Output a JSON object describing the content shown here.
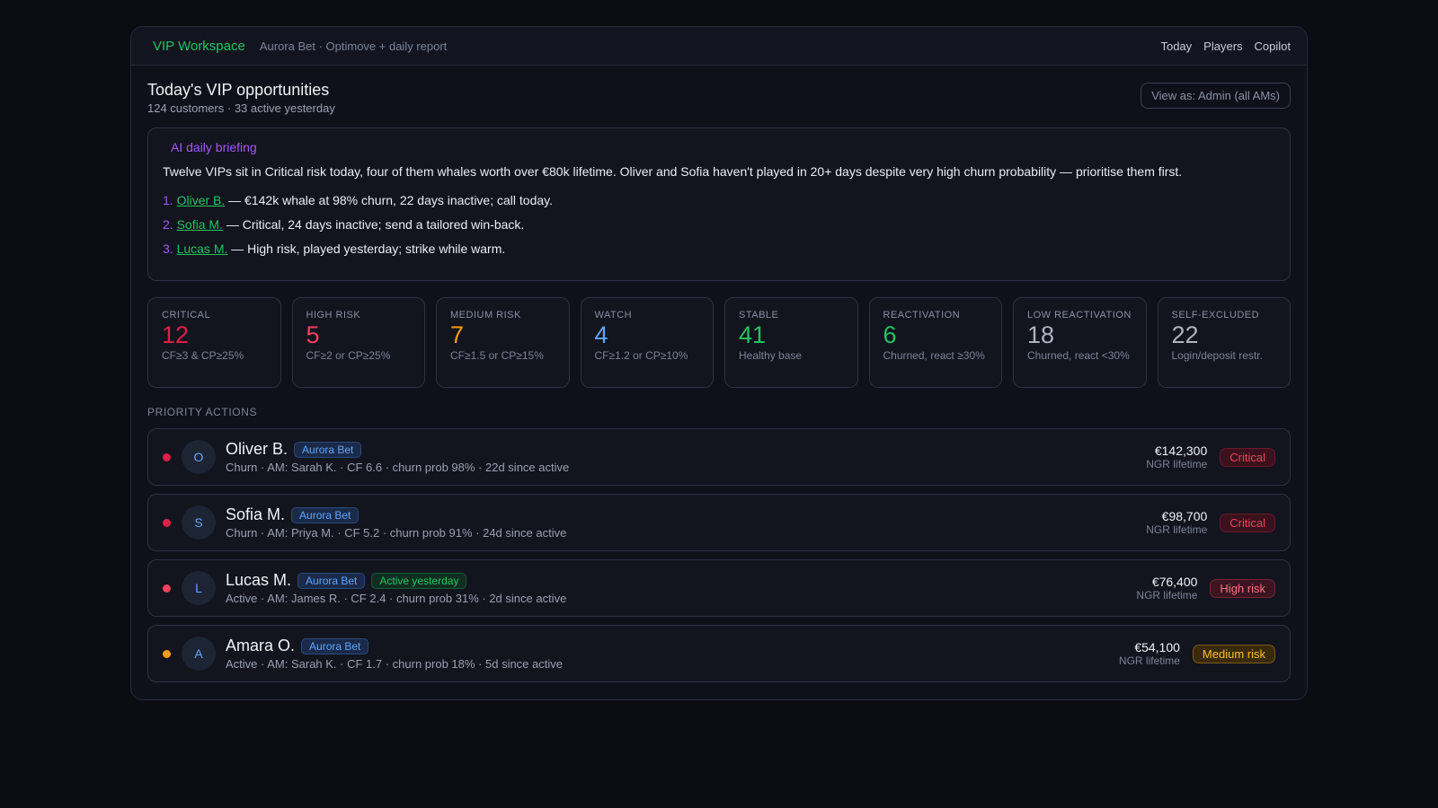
{
  "header": {
    "brand": "VIP Workspace",
    "subtitle": "Aurora Bet · Optimove + daily report",
    "nav": [
      "Today",
      "Players",
      "Copilot"
    ]
  },
  "page": {
    "title": "Today's VIP opportunities",
    "counts": "124 customers · 33 active yesterday",
    "view_as": "View as: Admin (all AMs)"
  },
  "briefing": {
    "label": "AI daily briefing",
    "text": "Twelve VIPs sit in Critical risk today, four of them whales worth over €80k lifetime. Oliver and Sofia haven't played in 20+ days despite very high churn probability — prioritise them first.",
    "items": [
      {
        "num": "1.",
        "name": "Oliver B.",
        "text": " — €142k whale at 98% churn, 22 days inactive; call today."
      },
      {
        "num": "2.",
        "name": "Sofia M.",
        "text": " — Critical, 24 days inactive; send a tailored win-back."
      },
      {
        "num": "3.",
        "name": "Lucas M.",
        "text": " — High risk, played yesterday; strike while warm."
      }
    ]
  },
  "stats": [
    {
      "label": "Critical",
      "value": "12",
      "desc": "CF≥3 & CP≥25%",
      "color": "#e11d48"
    },
    {
      "label": "High risk",
      "value": "5",
      "desc": "CF≥2 or CP≥25%",
      "color": "#f43f5e"
    },
    {
      "label": "Medium risk",
      "value": "7",
      "desc": "CF≥1.5 or CP≥15%",
      "color": "#f59e0b"
    },
    {
      "label": "Watch",
      "value": "4",
      "desc": "CF≥1.2 or CP≥10%",
      "color": "#60a5fa"
    },
    {
      "label": "Stable",
      "value": "41",
      "desc": "Healthy base",
      "color": "#22c55e"
    },
    {
      "label": "Reactivation",
      "value": "6",
      "desc": "Churned, react ≥30%",
      "color": "#22c55e"
    },
    {
      "label": "Low reactivation",
      "value": "18",
      "desc": "Churned, react <30%",
      "color": "#aeb3c0"
    },
    {
      "label": "Self-excluded",
      "value": "22",
      "desc": "Login/deposit restr.",
      "color": "#aeb3c0"
    }
  ],
  "priority_label": "Priority actions",
  "players": [
    {
      "initial": "O",
      "name": "Oliver B.",
      "brand": "Aurora Bet",
      "active_tag": "",
      "meta": "Churn · AM: Sarah K. · CF 6.6 · churn prob 98% · 22d since active",
      "amount": "€142,300",
      "ngr": "NGR lifetime",
      "badge": "Critical",
      "dot": "#e11d48",
      "badge_fg": "#f43f5e",
      "badge_bg": "#3a111c",
      "badge_border": "#6b1a2b"
    },
    {
      "initial": "S",
      "name": "Sofia M.",
      "brand": "Aurora Bet",
      "active_tag": "",
      "meta": "Churn · AM: Priya M. · CF 5.2 · churn prob 91% · 24d since active",
      "amount": "€98,700",
      "ngr": "NGR lifetime",
      "badge": "Critical",
      "dot": "#e11d48",
      "badge_fg": "#f43f5e",
      "badge_bg": "#3a111c",
      "badge_border": "#6b1a2b"
    },
    {
      "initial": "L",
      "name": "Lucas M.",
      "brand": "Aurora Bet",
      "active_tag": "Active yesterday",
      "meta": "Active · AM: James R. · CF 2.4 · churn prob 31% · 2d since active",
      "amount": "€76,400",
      "ngr": "NGR lifetime",
      "badge": "High risk",
      "dot": "#f43f5e",
      "badge_fg": "#fb7185",
      "badge_bg": "#3a1620",
      "badge_border": "#7a2436"
    },
    {
      "initial": "A",
      "name": "Amara O.",
      "brand": "Aurora Bet",
      "active_tag": "",
      "meta": "Active · AM: Sarah K. · CF 1.7 · churn prob 18% · 5d since active",
      "amount": "€54,100",
      "ngr": "NGR lifetime",
      "badge": "Medium risk",
      "dot": "#f59e0b",
      "badge_fg": "#fbbf24",
      "badge_bg": "#3a2a0c",
      "badge_border": "#7a5a14"
    }
  ]
}
